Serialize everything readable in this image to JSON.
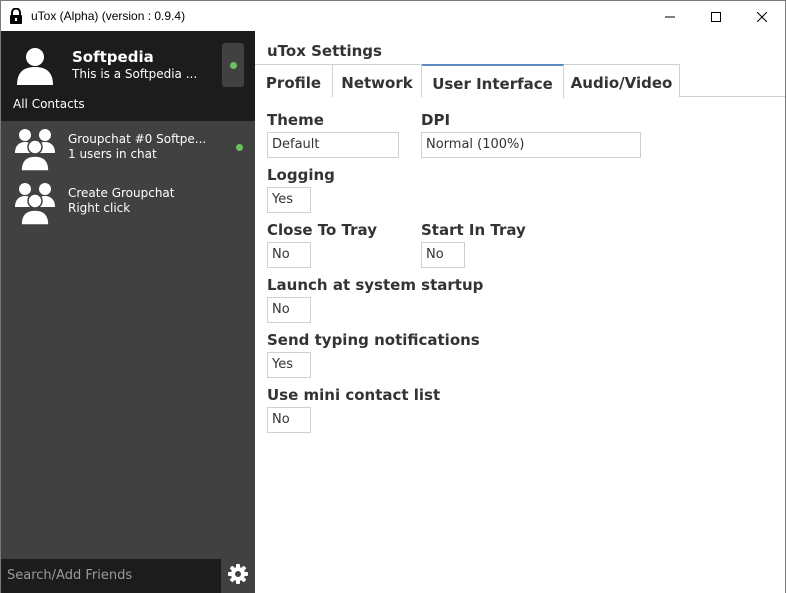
{
  "window": {
    "title": "uTox (Alpha) (version : 0.9.4)",
    "icons": [
      "utox-lock-icon",
      "minimize-icon",
      "maximize-icon",
      "close-icon"
    ]
  },
  "self": {
    "name": "Softpedia",
    "status_message": "This is a Softpedia ...",
    "status": "online",
    "status_color": "#6bc260"
  },
  "sidebar": {
    "section_label": "All Contacts",
    "contacts": [
      {
        "name": "Groupchat #0 Softpe...",
        "subtitle": "1 users in chat",
        "online": true
      },
      {
        "name": "Create Groupchat",
        "subtitle": "Right click",
        "online": false
      }
    ],
    "search_placeholder": "Search/Add Friends"
  },
  "settings": {
    "title": "uTox Settings",
    "tabs": [
      {
        "label": "Profile",
        "active": false
      },
      {
        "label": "Network",
        "active": false
      },
      {
        "label": "User Interface",
        "active": true
      },
      {
        "label": "Audio/Video",
        "active": false
      }
    ],
    "fields": {
      "theme": {
        "label": "Theme",
        "value": "Default"
      },
      "dpi": {
        "label": "DPI",
        "value": "Normal (100%)"
      },
      "logging": {
        "label": "Logging",
        "value": "Yes"
      },
      "close_to_tray": {
        "label": "Close To Tray",
        "value": "No"
      },
      "start_in_tray": {
        "label": "Start In Tray",
        "value": "No"
      },
      "launch_startup": {
        "label": "Launch at system startup",
        "value": "No"
      },
      "typing_notifications": {
        "label": "Send typing notifications",
        "value": "Yes"
      },
      "mini_contact_list": {
        "label": "Use mini contact list",
        "value": "No"
      }
    }
  },
  "colors": {
    "sidebar_bg": "#414141",
    "sidebar_dark": "#1c1c1c",
    "online_green": "#6bc260",
    "active_tab_accent": "#5c8ac1"
  }
}
